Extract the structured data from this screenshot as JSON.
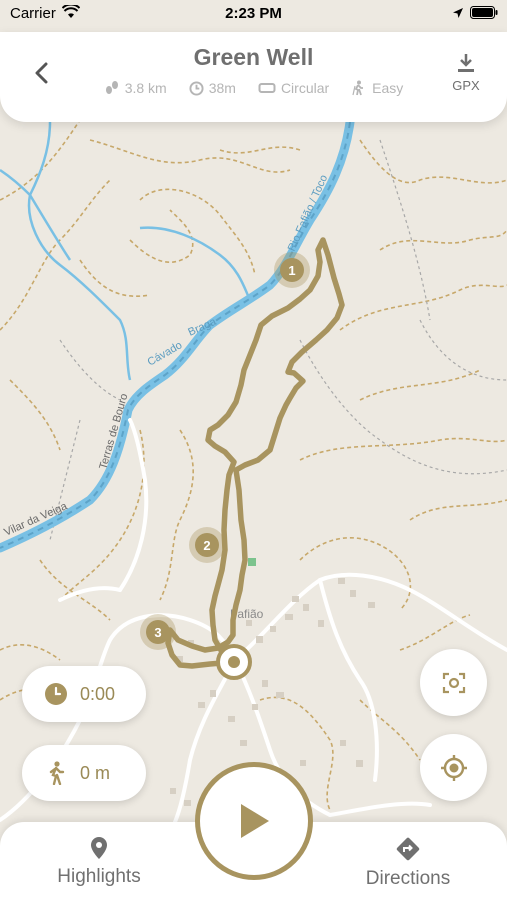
{
  "statusbar": {
    "carrier": "Carrier",
    "time": "2:23 PM"
  },
  "header": {
    "title": "Green Well",
    "distance": "3.8 km",
    "duration": "38m",
    "route_type": "Circular",
    "difficulty": "Easy",
    "gpx_label": "GPX"
  },
  "map": {
    "labels": {
      "river_top": "Rio Fafião / Toco",
      "braga": "Braga",
      "cavado": "Cávado",
      "terras": "Terras de Bouro",
      "vilar": "Vilar da Veiga",
      "village": "Fafião"
    },
    "markers": [
      "1",
      "2",
      "3"
    ]
  },
  "timer": {
    "value": "0:00"
  },
  "distance_walked": {
    "value": "0 m"
  },
  "tabs": {
    "highlights": "Highlights",
    "directions": "Directions"
  },
  "colors": {
    "accent": "#a8945f",
    "route": "#a8945f",
    "water": "#79c0e4",
    "road": "#ffffff",
    "contour": "#c7a86a"
  }
}
